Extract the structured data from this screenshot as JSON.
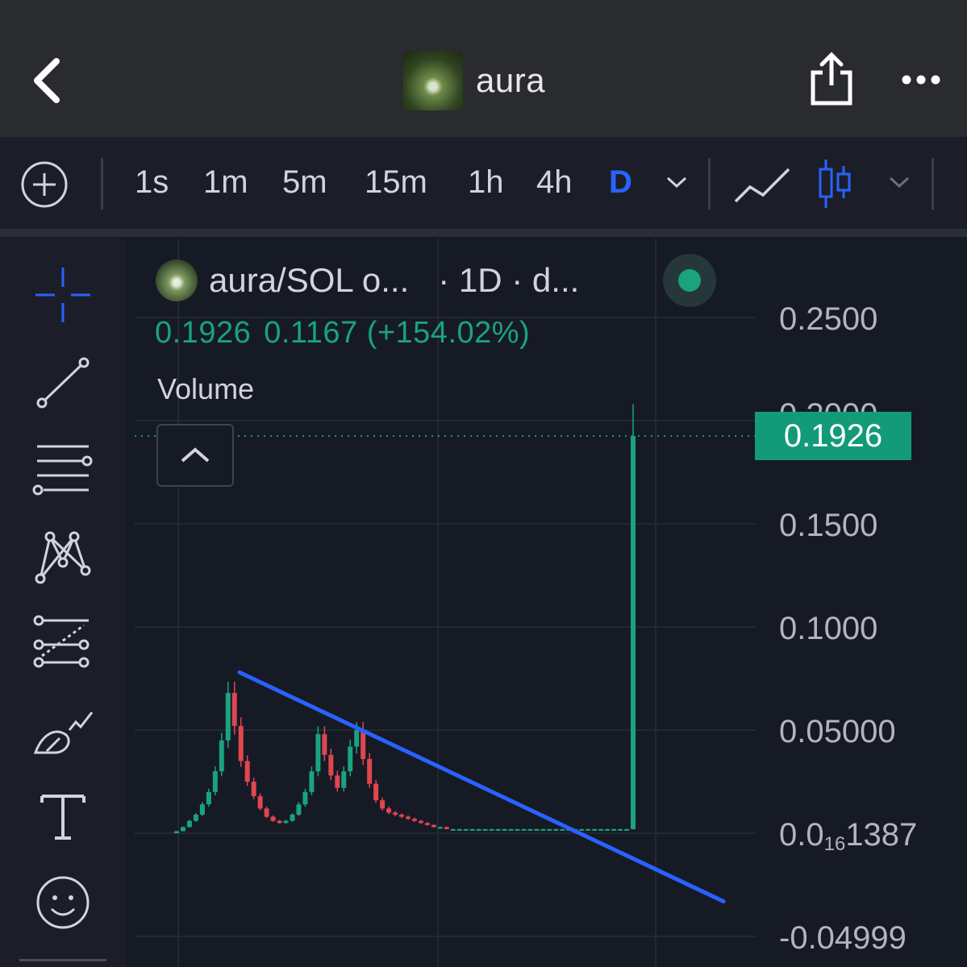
{
  "header": {
    "title": "aura"
  },
  "toolbar": {
    "timeframes": [
      "1s",
      "1m",
      "5m",
      "15m",
      "1h",
      "4h",
      "D"
    ],
    "active_timeframe": "D"
  },
  "legend": {
    "symbol": "aura/SOL o...",
    "interval": "· 1D · d...",
    "last_price": "0.1926",
    "change": "0.1167 (+154.02%)",
    "indicator": "Volume"
  },
  "price_scale": {
    "labels": [
      "0.2500",
      "0.1500",
      "0.1000",
      "0.05000",
      "-0.04999"
    ],
    "small_label": {
      "prefix": "0.0",
      "subscript": "16",
      "suffix": "1387"
    },
    "partial_label": "0.2000",
    "current_price": "0.1926"
  },
  "colors": {
    "up": "#1aa37c",
    "down": "#e0464f",
    "trendline": "#2962ff",
    "accent": "#2962ff"
  },
  "tools": [
    "crosshair-icon",
    "trendline-icon",
    "fib-levels-icon",
    "pattern-icon",
    "prediction-icon",
    "brush-icon",
    "text-icon",
    "emoji-icon"
  ],
  "chart_data": {
    "type": "candlestick",
    "series": [
      {
        "name": "aura/SOL",
        "x": [
          0,
          8,
          16,
          24,
          32,
          40,
          48,
          56,
          64,
          72,
          80,
          88,
          96,
          104,
          112,
          120,
          128,
          136,
          144,
          152,
          160,
          168,
          176,
          184,
          192,
          200,
          208,
          216,
          224,
          232,
          240,
          248,
          256,
          264,
          272,
          280,
          288,
          296,
          304,
          312,
          320,
          328,
          336,
          344,
          352,
          360,
          368,
          376,
          384,
          392,
          400,
          408,
          416,
          424,
          432,
          440,
          448,
          456,
          464,
          472,
          480,
          488,
          496,
          504,
          512,
          520,
          528,
          536,
          544,
          552,
          560,
          568
        ],
        "close": [
          0.001,
          0.003,
          0.006,
          0.009,
          0.014,
          0.02,
          0.03,
          0.045,
          0.068,
          0.052,
          0.035,
          0.025,
          0.018,
          0.012,
          0.008,
          0.006,
          0.005,
          0.006,
          0.009,
          0.014,
          0.02,
          0.03,
          0.048,
          0.038,
          0.028,
          0.022,
          0.03,
          0.042,
          0.05,
          0.036,
          0.024,
          0.016,
          0.012,
          0.01,
          0.009,
          0.008,
          0.007,
          0.006,
          0.005,
          0.004,
          0.003,
          0.003,
          0.002,
          0.002,
          0.002,
          0.002,
          0.002,
          0.002,
          0.002,
          0.002,
          0.002,
          0.002,
          0.002,
          0.002,
          0.002,
          0.002,
          0.002,
          0.002,
          0.002,
          0.002,
          0.002,
          0.002,
          0.002,
          0.002,
          0.002,
          0.002,
          0.002,
          0.002,
          0.002,
          0.002,
          0.002,
          0.1926
        ]
      }
    ],
    "ylim": [
      -0.04999,
      0.25
    ],
    "last": 0.1926
  }
}
